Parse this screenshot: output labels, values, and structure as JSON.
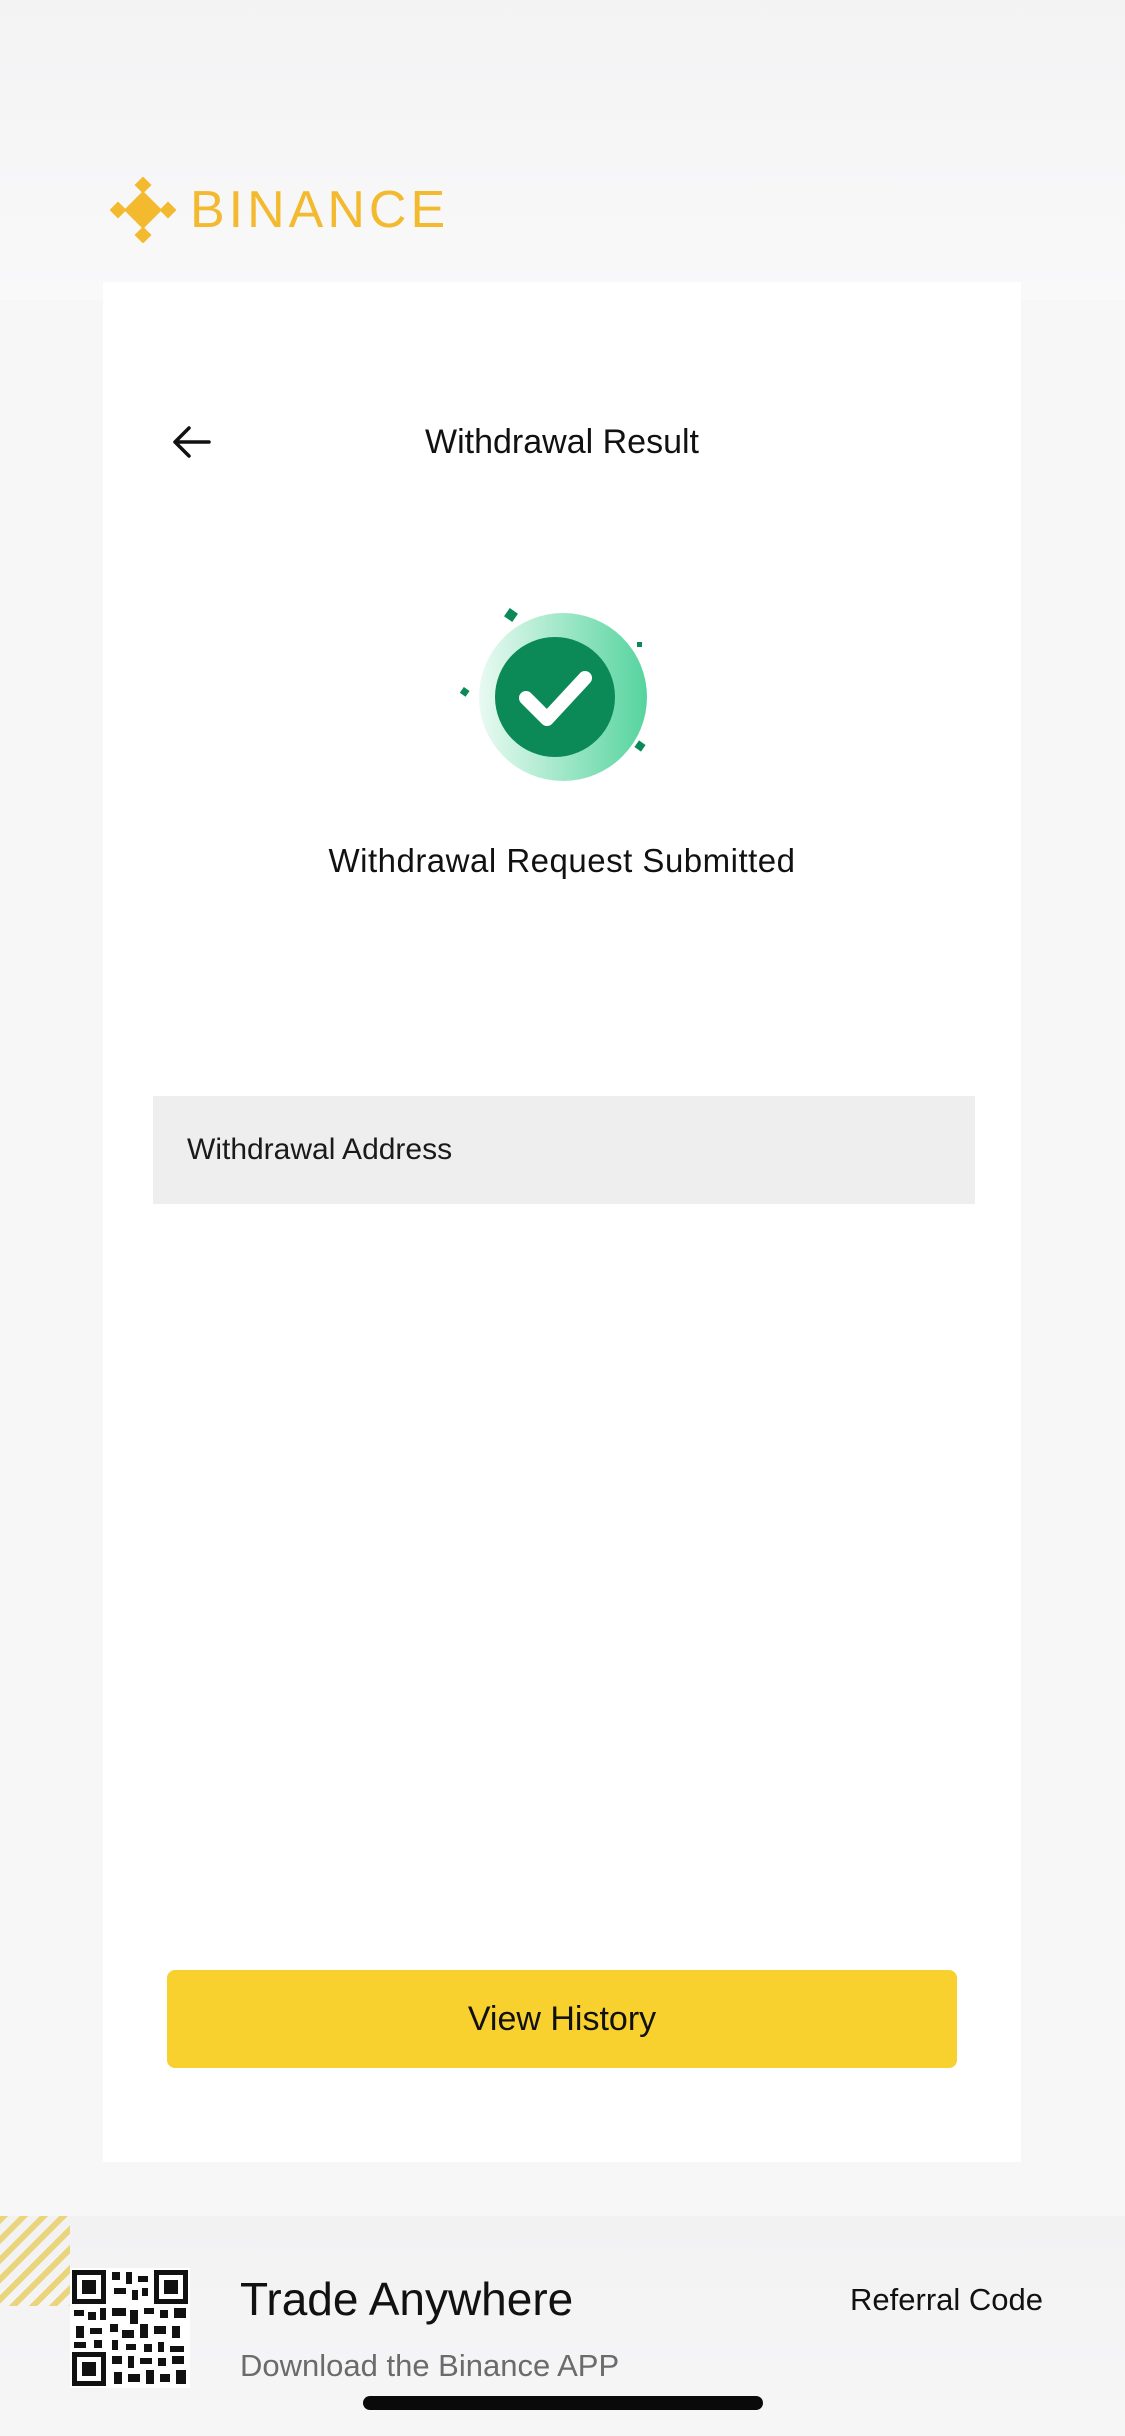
{
  "brand": {
    "logo_text": "BINANCE",
    "accent_color": "#F3BA2F"
  },
  "header": {
    "back_icon": "arrow-left-icon",
    "title": "Withdrawal Result"
  },
  "status": {
    "icon": "check-circle-icon",
    "color": "#0B8A57",
    "message": "Withdrawal Request Submitted"
  },
  "address": {
    "label": "Withdrawal Address"
  },
  "actions": {
    "view_history_label": "View History",
    "button_color": "#F8D12F"
  },
  "banner": {
    "title": "Trade Anywhere",
    "subtitle": "Download the Binance APP",
    "referral_label": "Referral Code",
    "qr_icon": "qr-code-icon"
  }
}
